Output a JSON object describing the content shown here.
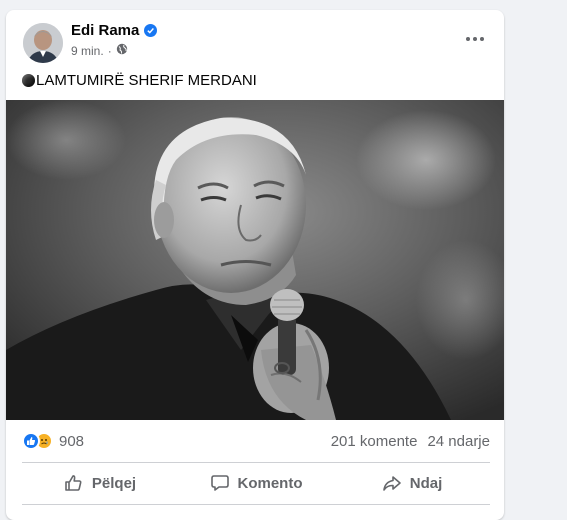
{
  "post": {
    "author": "Edi Rama",
    "time": "9 min.",
    "privacy_icon": "globe-icon",
    "text": "LAMTUMIRË SHERIF MERDANI",
    "text_prefix_icon": "black-circle-icon"
  },
  "stats": {
    "reaction_count": "908",
    "comments": "201 komente",
    "shares": "24 ndarje"
  },
  "actions": {
    "like": "Pëlqej",
    "comment": "Komento",
    "share": "Ndaj"
  },
  "colors": {
    "accent": "#1877f2",
    "secondary_text": "#65676b",
    "sad_reaction": "#f7b125"
  }
}
